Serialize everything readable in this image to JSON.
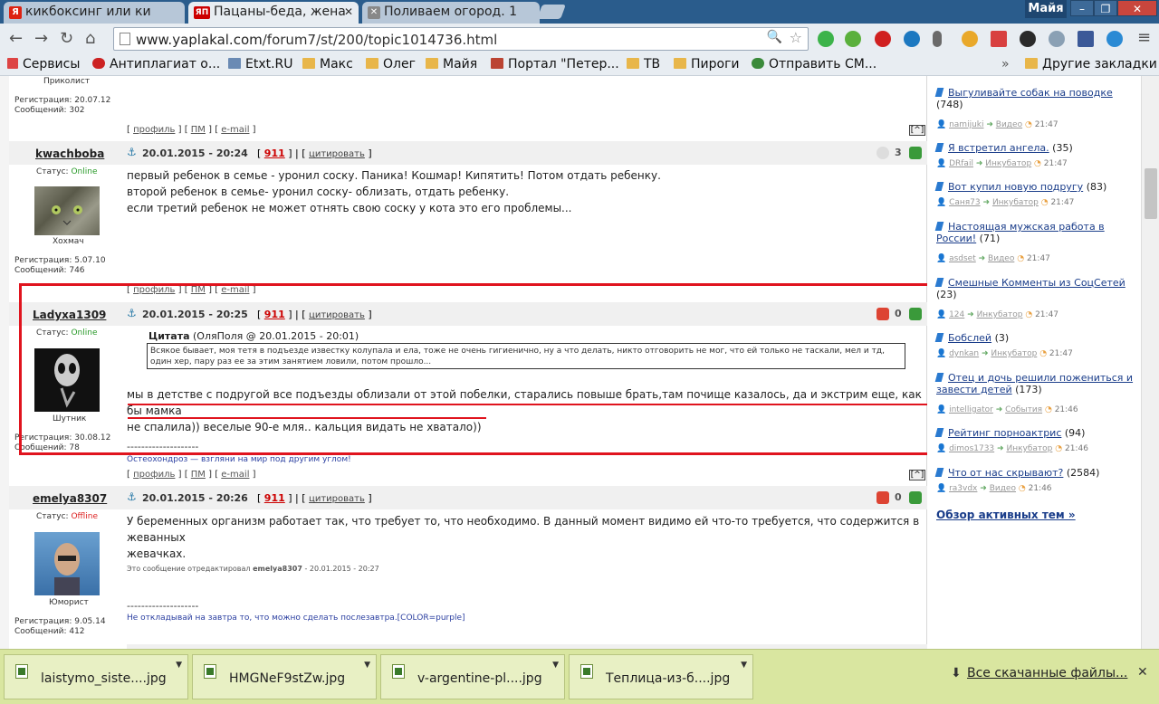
{
  "tabs": [
    {
      "label": "кикбоксинг или ки",
      "favicon": "Я"
    },
    {
      "label": "Пацаны-беда, жена",
      "favicon": "ЯП"
    },
    {
      "label": "Поливаем огород. 1",
      "favicon": "✕"
    }
  ],
  "window": {
    "user": "Майя",
    "minimize": "–",
    "restore": "❐",
    "close": "✕"
  },
  "toolbar": {
    "url_host": "www.yaplakal.com",
    "url_path": "/forum7/st/200/topic1014736.html"
  },
  "bookmarks": [
    {
      "label": "Сервисы"
    },
    {
      "label": "Антиплагиат о..."
    },
    {
      "label": "Etxt.RU"
    },
    {
      "label": "Макс"
    },
    {
      "label": "Олег"
    },
    {
      "label": "Майя"
    },
    {
      "label": "Портал \"Петер..."
    },
    {
      "label": "ТВ"
    },
    {
      "label": "Пироги"
    },
    {
      "label": "Отправить СМ..."
    }
  ],
  "bookmarks_more": "»",
  "bookmarks_other": "Другие закладки",
  "post0": {
    "rank": "Приколист",
    "reg": "Регистрация: 20.07.12",
    "msgs": "Сообщений: 302"
  },
  "post_links": {
    "profile": "профиль",
    "pm": "ПМ",
    "email": "e-mail",
    "up": "[^]"
  },
  "posts": [
    {
      "user": "kwachboba",
      "date": "20.01.2015 - 20:24",
      "num": "911",
      "quote": "цитировать",
      "votes": "3",
      "status_label": "Статус:",
      "status": "Online",
      "rank": "Хохмач",
      "reg": "Регистрация: 5.07.10",
      "msgs": "Сообщений: 746",
      "lines": [
        "первый ребенок в семье - уронил соску. Паника! Кошмар! Кипятить! Потом отдать ребенку.",
        "второй ребенок в семье- уронил соску- облизать, отдать ребенку.",
        "если третий ребенок не может отнять свою соску у кота это его проблемы..."
      ]
    },
    {
      "user": "Ladyxa1309",
      "date": "20.01.2015 - 20:25",
      "num": "911",
      "quote": "цитировать",
      "votes": "0",
      "status_label": "Статус:",
      "status": "Online",
      "rank": "Шутник",
      "reg": "Регистрация: 30.08.12",
      "msgs": "Сообщений: 78",
      "quote_title": "Цитата",
      "quote_meta": "(ОляПоля @ 20.01.2015 - 20:01)",
      "quote_text": "Всякое бывает, моя тетя в подъезде известку колупала и ела, тоже не очень гигиенично, ну а что делать, никто отговорить не мог, что ей только не таскали, мел и тд, один хер, пару раз ее за этим занятием ловили, потом прошло...",
      "lines": [
        "мы в детстве с подругой все подъезды облизали от этой побелки, старались повыше брать,там почище казалось, да и экстрим еще, как бы мамка",
        "не спалила)) веселые 90-е мля.. кальция видать не хватало))"
      ],
      "dashes": "--------------------",
      "sig": "Остеохондроз — взгляни на мир под другим углом!"
    },
    {
      "user": "emelya8307",
      "date": "20.01.2015 - 20:26",
      "num": "911",
      "quote": "цитировать",
      "votes": "0",
      "status_label": "Статус:",
      "status": "Offline",
      "rank": "Юморист",
      "reg": "Регистрация: 9.05.14",
      "msgs": "Сообщений: 412",
      "lines": [
        "У беременных организм работает так, что требует то, что необходимо. В данный момент видимо ей что-то требуется, что содержится в жеванных",
        "жевачках."
      ],
      "edited_prefix": "Это сообщение отредактировал",
      "edited_user": "emelya8307",
      "edited_date": "- 20.01.2015 - 20:27",
      "dashes": "--------------------",
      "sig": "Не откладывай на завтра то, что можно сделать послезавтра.[COLOR=purple]"
    }
  ],
  "sidebar": {
    "items": [
      {
        "title": "Выгуливайте собак на поводке",
        "count": "(748)",
        "author": "namijuki",
        "section": "Видео",
        "time": "21:47"
      },
      {
        "title": "Я встретил ангела.",
        "count": "(35)",
        "author": "DRfail",
        "section": "Инкубатор",
        "time": "21:47"
      },
      {
        "title": "Вот купил новую подругу",
        "count": "(83)",
        "author": "Саня73",
        "section": "Инкубатор",
        "time": "21:47"
      },
      {
        "title": "Настоящая мужская работа в России!",
        "count": "(71)",
        "author": "asdset",
        "section": "Видео",
        "time": "21:47"
      },
      {
        "title": "Смешные Комменты из СоцСетей",
        "count": "(23)",
        "author": "124",
        "section": "Инкубатор",
        "time": "21:47"
      },
      {
        "title": "Бобслей",
        "count": "(3)",
        "author": "dynkan",
        "section": "Инкубатор",
        "time": "21:47"
      },
      {
        "title": "Отец и дочь решили пожениться и завести детей",
        "count": "(173)",
        "author": "intelligator",
        "section": "События",
        "time": "21:46"
      },
      {
        "title": "Рейтинг порноактрис",
        "count": "(94)",
        "author": "dimos1733",
        "section": "Инкубатор",
        "time": "21:46"
      },
      {
        "title": "Что от нас скрывают?",
        "count": "(2584)",
        "author": "ra3vdx",
        "section": "Видео",
        "time": "21:46"
      }
    ],
    "overview": "Обзор активных тем »"
  },
  "downloads": {
    "items": [
      {
        "name": "laistymo_siste....jpg"
      },
      {
        "name": "HMGNeF9stZw.jpg"
      },
      {
        "name": "v-argentine-pl....jpg"
      },
      {
        "name": "Теплица-из-б....jpg"
      }
    ],
    "all": "Все скачанные файлы...",
    "close": "✕"
  }
}
